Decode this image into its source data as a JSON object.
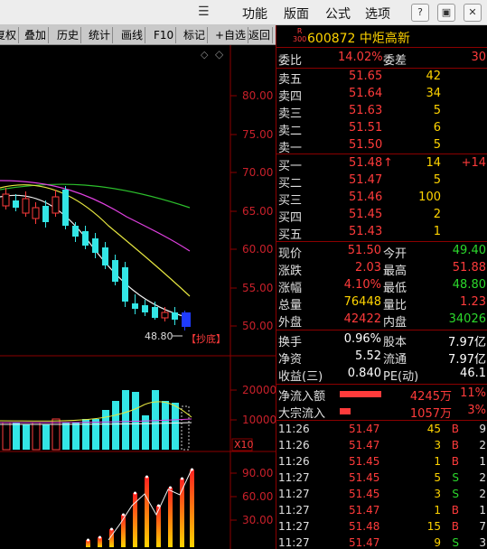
{
  "titlebar": {
    "menus": [
      "功能",
      "版面",
      "公式",
      "选项"
    ],
    "buttons": [
      "?",
      "▣",
      "✕"
    ]
  },
  "toolbar": {
    "items": [
      "复权",
      "叠加",
      "历史",
      "统计",
      "画线",
      "F10",
      "标记",
      "+自选",
      "返回"
    ]
  },
  "chart": {
    "price_ticks": [
      "80.00",
      "75.00",
      "70.00",
      "65.00",
      "60.00",
      "55.00",
      "50.00"
    ],
    "low_marker": "48.80",
    "signal_label": "【抄底】",
    "volume_ticks": [
      "20000",
      "10000"
    ],
    "volume_unit": "X10",
    "indicator_ticks": [
      "90.00",
      "60.00",
      "30.00"
    ]
  },
  "stock": {
    "r_tag_top": "R",
    "r_tag_bottom": "300",
    "code": "600872",
    "name": "中炬高新"
  },
  "quote": {
    "weibi_label": "委比",
    "weibi": "14.02%",
    "weicha_label": "委差",
    "weicha": "30",
    "asks": [
      {
        "label": "卖五",
        "price": "51.65",
        "vol": "42"
      },
      {
        "label": "卖四",
        "price": "51.64",
        "vol": "34"
      },
      {
        "label": "卖三",
        "price": "51.63",
        "vol": "5"
      },
      {
        "label": "卖二",
        "price": "51.51",
        "vol": "6"
      },
      {
        "label": "卖一",
        "price": "51.50",
        "vol": "5"
      }
    ],
    "bids": [
      {
        "label": "买一",
        "price": "51.48",
        "arrow": "↑",
        "vol": "14",
        "extra": "+14"
      },
      {
        "label": "买二",
        "price": "51.47",
        "arrow": "",
        "vol": "5",
        "extra": ""
      },
      {
        "label": "买三",
        "price": "51.46",
        "arrow": "",
        "vol": "100",
        "extra": ""
      },
      {
        "label": "买四",
        "price": "51.45",
        "arrow": "",
        "vol": "2",
        "extra": ""
      },
      {
        "label": "买五",
        "price": "51.43",
        "arrow": "",
        "vol": "1",
        "extra": ""
      }
    ],
    "stats": [
      {
        "l1": "现价",
        "v1": "51.50",
        "c1": "red",
        "l2": "今开",
        "v2": "49.40",
        "c2": "green"
      },
      {
        "l1": "涨跌",
        "v1": "2.03",
        "c1": "red",
        "l2": "最高",
        "v2": "51.88",
        "c2": "red"
      },
      {
        "l1": "涨幅",
        "v1": "4.10%",
        "c1": "red",
        "l2": "最低",
        "v2": "48.80",
        "c2": "green"
      },
      {
        "l1": "总量",
        "v1": "76448",
        "c1": "yellow",
        "l2": "量比",
        "v2": "1.23",
        "c2": "red"
      },
      {
        "l1": "外盘",
        "v1": "42422",
        "c1": "red",
        "l2": "内盘",
        "v2": "34026",
        "c2": "green"
      }
    ],
    "stats2": [
      {
        "l1": "换手",
        "v1": "0.96%",
        "l2": "股本",
        "v2": "7.97亿"
      },
      {
        "l1": "净资",
        "v1": "5.52",
        "l2": "流通",
        "v2": "7.97亿"
      },
      {
        "l1": "收益(三)",
        "v1": "0.840",
        "l2": "PE(动)",
        "v2": "46.1"
      }
    ],
    "flows": [
      {
        "label": "净流入额",
        "value": "4245万",
        "pct": "11%",
        "bar": 0.8
      },
      {
        "label": "大宗流入",
        "value": "1057万",
        "pct": "3%",
        "bar": 0.2
      }
    ]
  },
  "ticks": [
    {
      "time": "11:26",
      "price": "51.47",
      "vol": "45",
      "side": "B",
      "n": "9"
    },
    {
      "time": "11:26",
      "price": "51.47",
      "vol": "3",
      "side": "B",
      "n": "2"
    },
    {
      "time": "11:26",
      "price": "51.45",
      "vol": "1",
      "side": "B",
      "n": "1"
    },
    {
      "time": "11:27",
      "price": "51.45",
      "vol": "5",
      "side": "S",
      "n": "2"
    },
    {
      "time": "11:27",
      "price": "51.45",
      "vol": "3",
      "side": "S",
      "n": "2"
    },
    {
      "time": "11:27",
      "price": "51.47",
      "vol": "1",
      "side": "B",
      "n": "1"
    },
    {
      "time": "11:27",
      "price": "51.48",
      "vol": "15",
      "side": "B",
      "n": "7"
    },
    {
      "time": "11:27",
      "price": "51.47",
      "vol": "9",
      "side": "S",
      "n": "3"
    }
  ],
  "colors": {
    "up": "#ff3b3b",
    "down": "#2cd92c",
    "cyan": "#33e6e6",
    "yellow": "#ffd400",
    "magenta": "#e040e0",
    "white": "#f0f0f0",
    "ma_green": "#2cbf2c"
  }
}
